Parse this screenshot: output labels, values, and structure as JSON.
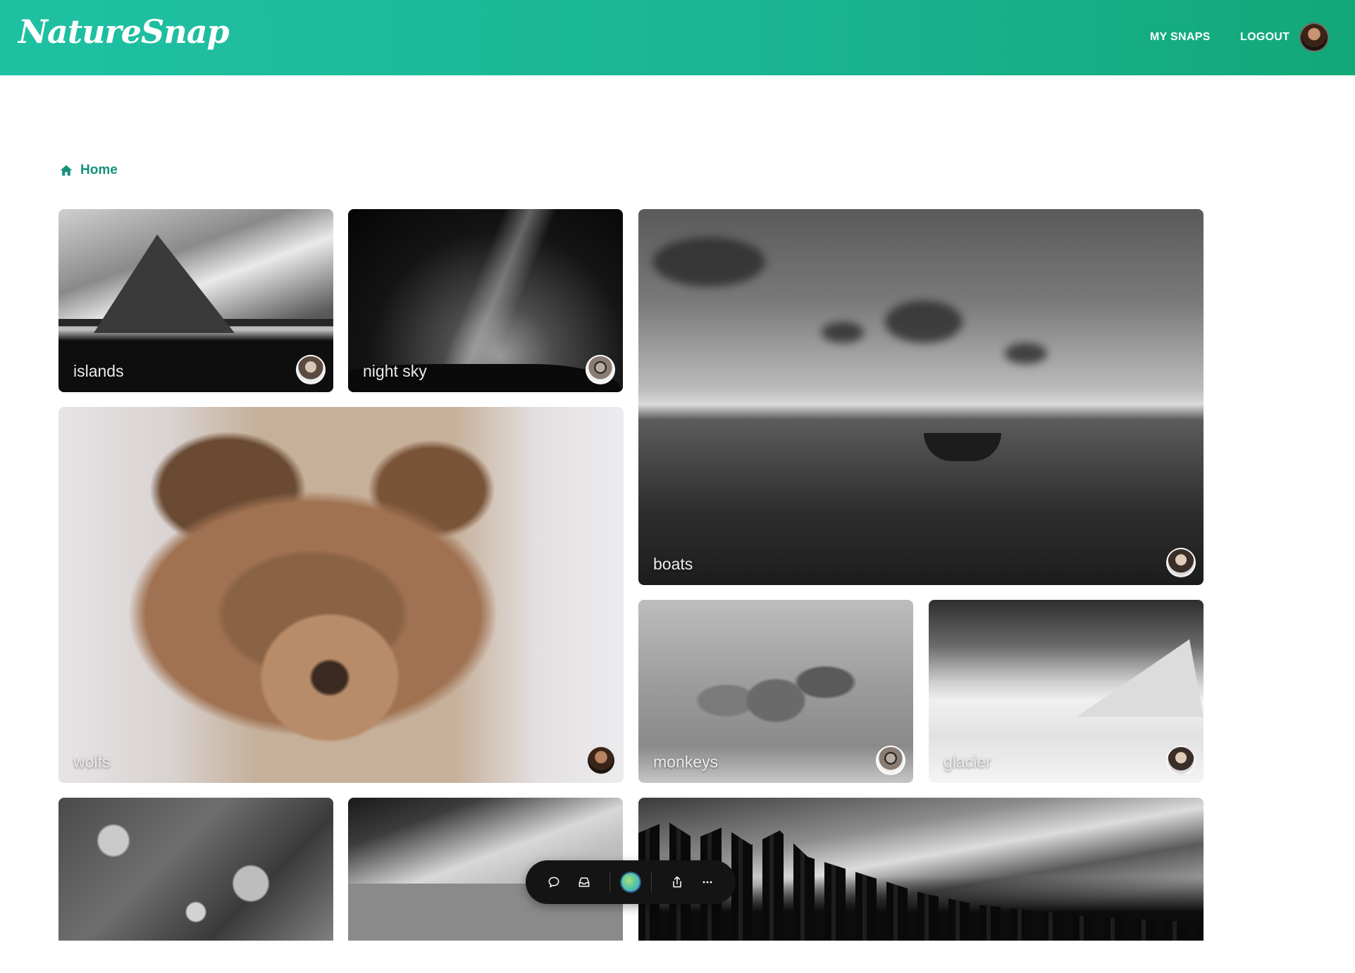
{
  "app": {
    "logo": "NatureSnap",
    "nav": {
      "my_snaps": "MY SNAPS",
      "logout": "LOGOUT"
    }
  },
  "breadcrumb": {
    "label": "Home",
    "icon": "home-icon"
  },
  "colors": {
    "brand": "#1ab594",
    "breadcrumb": "#15917a",
    "toolbar": "#141414"
  },
  "gallery": {
    "tiles": [
      {
        "label": "islands",
        "avatar": "user-avatar"
      },
      {
        "label": "night sky",
        "avatar": "user-avatar"
      },
      {
        "label": "boats",
        "avatar": "user-avatar"
      },
      {
        "label": "wolfs",
        "avatar": "user-avatar"
      },
      {
        "label": "monkeys",
        "avatar": "user-avatar"
      },
      {
        "label": "glacier",
        "avatar": "user-avatar"
      },
      {
        "label": "",
        "avatar": ""
      },
      {
        "label": "",
        "avatar": ""
      },
      {
        "label": "",
        "avatar": ""
      }
    ]
  },
  "toolbar": {
    "icons": [
      "comment-icon",
      "inbox-icon",
      "color-dot",
      "share-icon",
      "more-icon"
    ]
  }
}
